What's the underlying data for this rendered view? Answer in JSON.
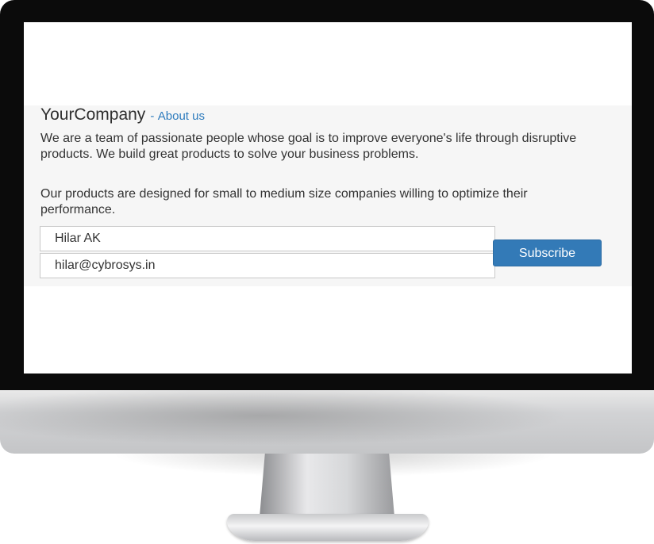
{
  "company": {
    "name": "YourCompany",
    "separator": "-",
    "about_link": "About us"
  },
  "paragraphs": [
    "We are a team of passionate people whose goal is to improve everyone's life through disruptive products. We build great products to solve your business problems.",
    "Our products are designed for small to medium size companies willing to optimize their performance."
  ],
  "form": {
    "name_value": "Hilar AK",
    "email_value": "hilar@cybrosys.in",
    "subscribe_label": "Subscribe"
  },
  "colors": {
    "accent": "#337ab7",
    "link": "#2d7bbd",
    "section_background": "#f6f6f6"
  }
}
